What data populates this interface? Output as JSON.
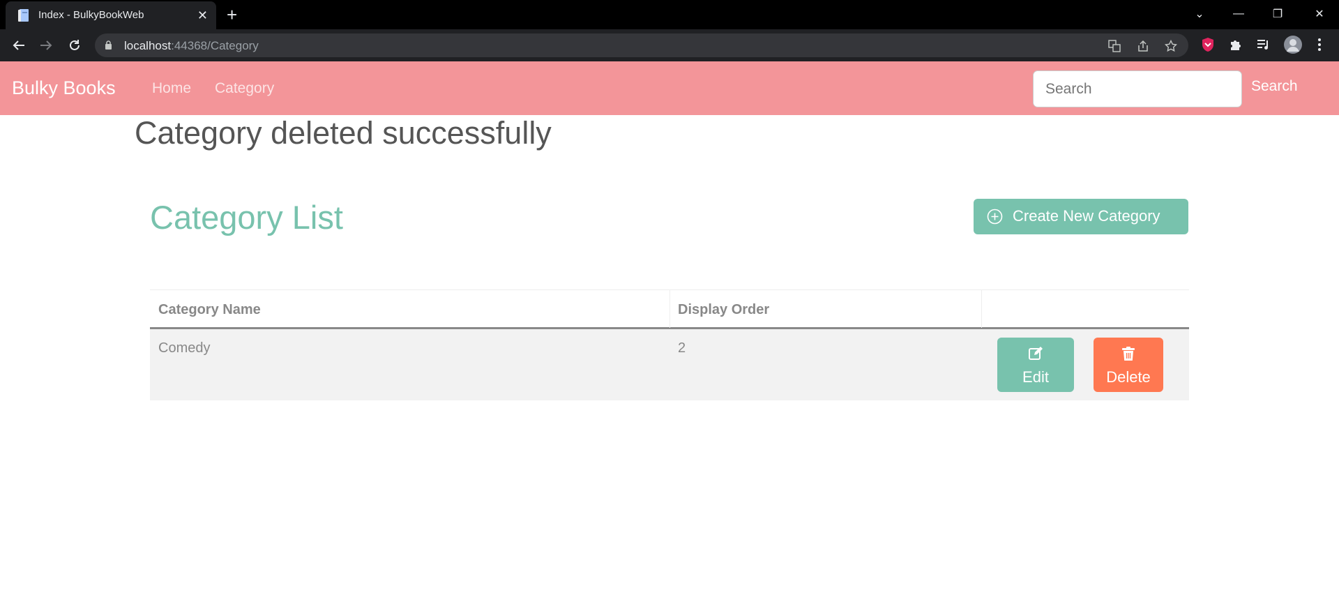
{
  "browser": {
    "tab_title": "Index - BulkyBookWeb",
    "tab_close": "✕",
    "new_tab": "+",
    "url_host": "localhost",
    "url_path": ":44368/Category",
    "window_controls": {
      "list": "⌄",
      "minimize": "—",
      "restore": "❐",
      "close": "✕"
    }
  },
  "navbar": {
    "brand": "Bulky Books",
    "links": [
      "Home",
      "Category"
    ],
    "search_placeholder": "Search",
    "search_button": "Search"
  },
  "alert": "Category deleted successfully",
  "list": {
    "title": "Category List",
    "create_button": "Create New Category"
  },
  "table": {
    "headers": [
      "Category Name",
      "Display Order",
      ""
    ],
    "rows": [
      {
        "name": "Comedy",
        "display_order": "2",
        "edit_label": "Edit",
        "delete_label": "Delete"
      }
    ]
  },
  "colors": {
    "navbar": "#f39599",
    "primary": "#78c2ad",
    "danger": "#ff7851"
  }
}
